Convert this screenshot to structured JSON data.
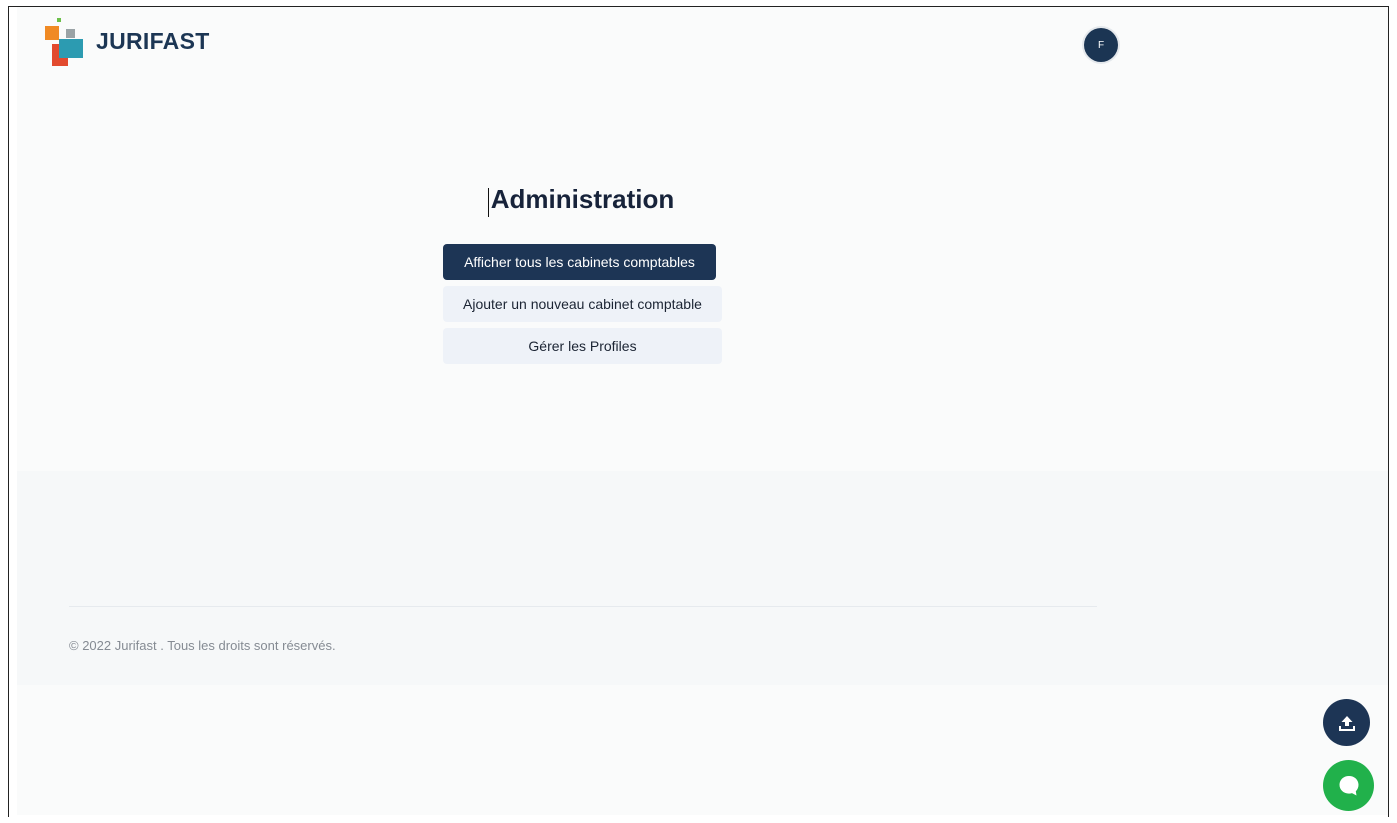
{
  "header": {
    "logo_text": "JURIFAST",
    "avatar_initial": "F"
  },
  "main": {
    "title": "Administration",
    "buttons": {
      "show_all": "Afficher tous les cabinets comptables",
      "add_new": "Ajouter un nouveau cabinet comptable",
      "manage_profiles": "Gérer les Profiles"
    }
  },
  "footer": {
    "copyright": "© 2022 Jurifast . Tous les droits sont réservés."
  },
  "floating": {
    "upload_icon": "upload-icon",
    "chat_icon": "chat-icon"
  },
  "colors": {
    "primary": "#1d3555",
    "chat": "#21b14b",
    "light_button": "#eef2f8"
  }
}
